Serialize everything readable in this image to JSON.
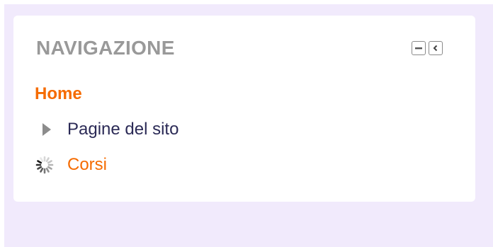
{
  "navigation_block": {
    "title": "NAVIGAZIONE",
    "controls": {
      "collapse_icon": "minus-box-icon",
      "dock_icon": "dock-left-icon"
    },
    "items": [
      {
        "label": "Home",
        "icon": null
      },
      {
        "label": "Pagine del sito",
        "icon": "triangle-right-icon"
      },
      {
        "label": "Corsi",
        "icon": "loading-spinner-icon"
      }
    ]
  },
  "colors": {
    "background": "#f1eafc",
    "accent": "#f56b00",
    "link_dark": "#2b2a56",
    "title_gray": "#999999"
  }
}
